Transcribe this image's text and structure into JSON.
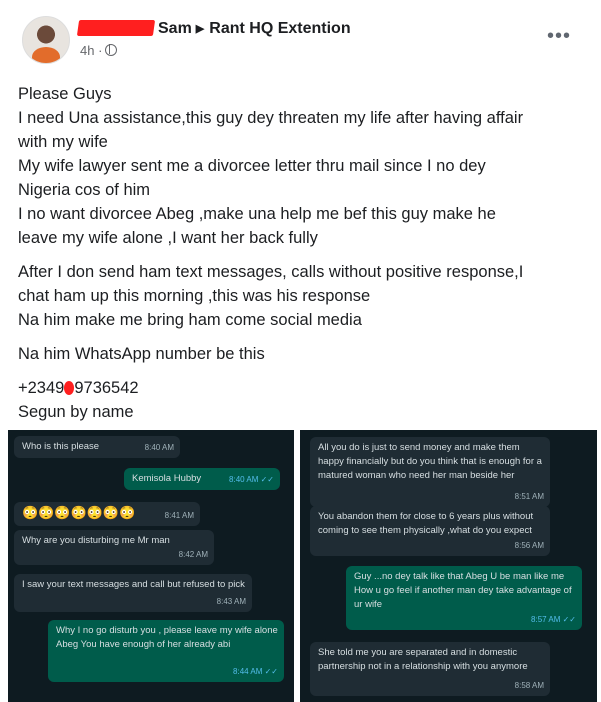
{
  "post_header": {
    "author": "Sam",
    "group": "Rant HQ Extention",
    "timestamp": "4h ·",
    "more_icon": "…",
    "privacy_icon": "globe-icon"
  },
  "post_text": {
    "line1": "Please Guys",
    "line2": "I need Una assistance,this guy dey threaten my life after having affair",
    "line3": "with my wife",
    "line4": "My wife lawyer sent me a divorcee letter thru mail since I no dey",
    "line5": "Nigeria cos of him",
    "line6": "I no want divorcee Abeg ,make una help me bef this guy make he",
    "line7": "leave my wife alone ,I want her back fully",
    "line8": "After I don send ham text messages, calls without positive response,I",
    "line9": "chat ham up this morning ,this was his response",
    "line10": "Na him make me bring ham come social media",
    "line11": "Na him WhatsApp number be this",
    "phone_start": "+2349",
    "phone_end": "9736542",
    "line13": "Segun by name"
  },
  "left_chat": [
    {
      "text": "Who is this please",
      "time": "8:40 AM",
      "dir": "in"
    },
    {
      "text": "Kemisola Hubby",
      "time": "8:40 AM ✓✓",
      "dir": "out"
    },
    {
      "text": "😳😳😳😳😳😳😳",
      "time": "8:41 AM",
      "dir": "in"
    },
    {
      "text": "Why are you disturbing me Mr man",
      "time": "8:42 AM",
      "dir": "in"
    },
    {
      "text": "I saw your text messages and call but refused to pick",
      "time": "8:43 AM",
      "dir": "in"
    },
    {
      "text": "Why I no go disturb you , please leave my wife alone Abeg You have enough of her already abi",
      "time": "8:44 AM ✓✓",
      "dir": "out"
    }
  ],
  "right_chat": [
    {
      "text": "All you do is just to send money and make them happy financially but do you think that is enough for a matured woman who need her man beside her",
      "time": "8:51 AM",
      "dir": "in"
    },
    {
      "text": "You abandon them for close to 6 years plus without coming to see them physically ,what do you expect",
      "time": "8:56 AM",
      "dir": "in"
    },
    {
      "text": "Guy ...no dey talk like that Abeg U be man like me How u go feel if another man dey take advantage of ur wife",
      "time": "8:57 AM ✓✓",
      "dir": "out"
    },
    {
      "text": "She told me you are separated and in domestic partnership not in a relationship with you anymore",
      "time": "8:58 AM",
      "dir": "in"
    }
  ]
}
